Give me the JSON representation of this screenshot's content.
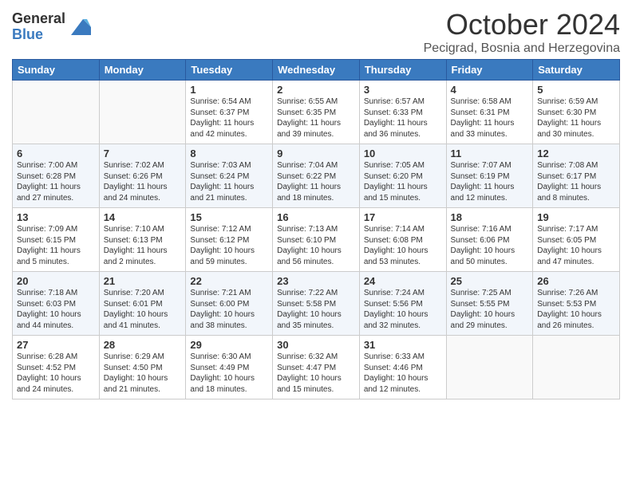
{
  "logo": {
    "general": "General",
    "blue": "Blue"
  },
  "title": "October 2024",
  "location": "Pecigrad, Bosnia and Herzegovina",
  "days_of_week": [
    "Sunday",
    "Monday",
    "Tuesday",
    "Wednesday",
    "Thursday",
    "Friday",
    "Saturday"
  ],
  "weeks": [
    [
      {
        "day": "",
        "sunrise": "",
        "sunset": "",
        "daylight": ""
      },
      {
        "day": "",
        "sunrise": "",
        "sunset": "",
        "daylight": ""
      },
      {
        "day": "1",
        "sunrise": "Sunrise: 6:54 AM",
        "sunset": "Sunset: 6:37 PM",
        "daylight": "Daylight: 11 hours and 42 minutes."
      },
      {
        "day": "2",
        "sunrise": "Sunrise: 6:55 AM",
        "sunset": "Sunset: 6:35 PM",
        "daylight": "Daylight: 11 hours and 39 minutes."
      },
      {
        "day": "3",
        "sunrise": "Sunrise: 6:57 AM",
        "sunset": "Sunset: 6:33 PM",
        "daylight": "Daylight: 11 hours and 36 minutes."
      },
      {
        "day": "4",
        "sunrise": "Sunrise: 6:58 AM",
        "sunset": "Sunset: 6:31 PM",
        "daylight": "Daylight: 11 hours and 33 minutes."
      },
      {
        "day": "5",
        "sunrise": "Sunrise: 6:59 AM",
        "sunset": "Sunset: 6:30 PM",
        "daylight": "Daylight: 11 hours and 30 minutes."
      }
    ],
    [
      {
        "day": "6",
        "sunrise": "Sunrise: 7:00 AM",
        "sunset": "Sunset: 6:28 PM",
        "daylight": "Daylight: 11 hours and 27 minutes."
      },
      {
        "day": "7",
        "sunrise": "Sunrise: 7:02 AM",
        "sunset": "Sunset: 6:26 PM",
        "daylight": "Daylight: 11 hours and 24 minutes."
      },
      {
        "day": "8",
        "sunrise": "Sunrise: 7:03 AM",
        "sunset": "Sunset: 6:24 PM",
        "daylight": "Daylight: 11 hours and 21 minutes."
      },
      {
        "day": "9",
        "sunrise": "Sunrise: 7:04 AM",
        "sunset": "Sunset: 6:22 PM",
        "daylight": "Daylight: 11 hours and 18 minutes."
      },
      {
        "day": "10",
        "sunrise": "Sunrise: 7:05 AM",
        "sunset": "Sunset: 6:20 PM",
        "daylight": "Daylight: 11 hours and 15 minutes."
      },
      {
        "day": "11",
        "sunrise": "Sunrise: 7:07 AM",
        "sunset": "Sunset: 6:19 PM",
        "daylight": "Daylight: 11 hours and 12 minutes."
      },
      {
        "day": "12",
        "sunrise": "Sunrise: 7:08 AM",
        "sunset": "Sunset: 6:17 PM",
        "daylight": "Daylight: 11 hours and 8 minutes."
      }
    ],
    [
      {
        "day": "13",
        "sunrise": "Sunrise: 7:09 AM",
        "sunset": "Sunset: 6:15 PM",
        "daylight": "Daylight: 11 hours and 5 minutes."
      },
      {
        "day": "14",
        "sunrise": "Sunrise: 7:10 AM",
        "sunset": "Sunset: 6:13 PM",
        "daylight": "Daylight: 11 hours and 2 minutes."
      },
      {
        "day": "15",
        "sunrise": "Sunrise: 7:12 AM",
        "sunset": "Sunset: 6:12 PM",
        "daylight": "Daylight: 10 hours and 59 minutes."
      },
      {
        "day": "16",
        "sunrise": "Sunrise: 7:13 AM",
        "sunset": "Sunset: 6:10 PM",
        "daylight": "Daylight: 10 hours and 56 minutes."
      },
      {
        "day": "17",
        "sunrise": "Sunrise: 7:14 AM",
        "sunset": "Sunset: 6:08 PM",
        "daylight": "Daylight: 10 hours and 53 minutes."
      },
      {
        "day": "18",
        "sunrise": "Sunrise: 7:16 AM",
        "sunset": "Sunset: 6:06 PM",
        "daylight": "Daylight: 10 hours and 50 minutes."
      },
      {
        "day": "19",
        "sunrise": "Sunrise: 7:17 AM",
        "sunset": "Sunset: 6:05 PM",
        "daylight": "Daylight: 10 hours and 47 minutes."
      }
    ],
    [
      {
        "day": "20",
        "sunrise": "Sunrise: 7:18 AM",
        "sunset": "Sunset: 6:03 PM",
        "daylight": "Daylight: 10 hours and 44 minutes."
      },
      {
        "day": "21",
        "sunrise": "Sunrise: 7:20 AM",
        "sunset": "Sunset: 6:01 PM",
        "daylight": "Daylight: 10 hours and 41 minutes."
      },
      {
        "day": "22",
        "sunrise": "Sunrise: 7:21 AM",
        "sunset": "Sunset: 6:00 PM",
        "daylight": "Daylight: 10 hours and 38 minutes."
      },
      {
        "day": "23",
        "sunrise": "Sunrise: 7:22 AM",
        "sunset": "Sunset: 5:58 PM",
        "daylight": "Daylight: 10 hours and 35 minutes."
      },
      {
        "day": "24",
        "sunrise": "Sunrise: 7:24 AM",
        "sunset": "Sunset: 5:56 PM",
        "daylight": "Daylight: 10 hours and 32 minutes."
      },
      {
        "day": "25",
        "sunrise": "Sunrise: 7:25 AM",
        "sunset": "Sunset: 5:55 PM",
        "daylight": "Daylight: 10 hours and 29 minutes."
      },
      {
        "day": "26",
        "sunrise": "Sunrise: 7:26 AM",
        "sunset": "Sunset: 5:53 PM",
        "daylight": "Daylight: 10 hours and 26 minutes."
      }
    ],
    [
      {
        "day": "27",
        "sunrise": "Sunrise: 6:28 AM",
        "sunset": "Sunset: 4:52 PM",
        "daylight": "Daylight: 10 hours and 24 minutes."
      },
      {
        "day": "28",
        "sunrise": "Sunrise: 6:29 AM",
        "sunset": "Sunset: 4:50 PM",
        "daylight": "Daylight: 10 hours and 21 minutes."
      },
      {
        "day": "29",
        "sunrise": "Sunrise: 6:30 AM",
        "sunset": "Sunset: 4:49 PM",
        "daylight": "Daylight: 10 hours and 18 minutes."
      },
      {
        "day": "30",
        "sunrise": "Sunrise: 6:32 AM",
        "sunset": "Sunset: 4:47 PM",
        "daylight": "Daylight: 10 hours and 15 minutes."
      },
      {
        "day": "31",
        "sunrise": "Sunrise: 6:33 AM",
        "sunset": "Sunset: 4:46 PM",
        "daylight": "Daylight: 10 hours and 12 minutes."
      },
      {
        "day": "",
        "sunrise": "",
        "sunset": "",
        "daylight": ""
      },
      {
        "day": "",
        "sunrise": "",
        "sunset": "",
        "daylight": ""
      }
    ]
  ]
}
